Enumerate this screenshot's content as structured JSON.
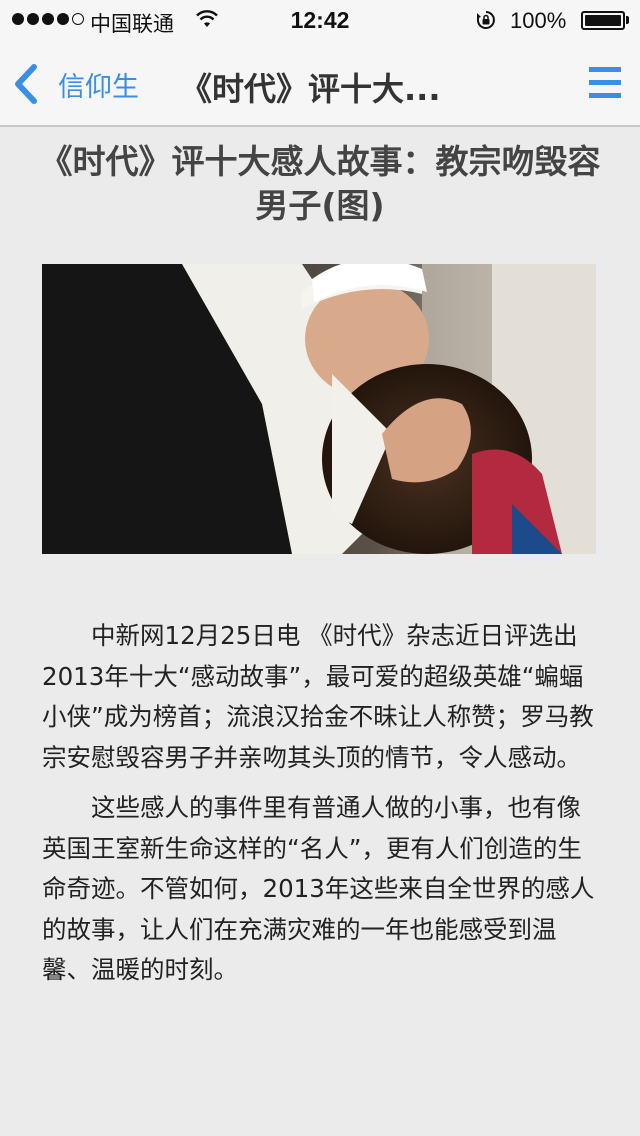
{
  "status_bar": {
    "signal_bars": 4,
    "signal_total": 5,
    "carrier": "中国联通",
    "time": "12:42",
    "battery_percent": "100%",
    "battery_level": 1.0
  },
  "nav": {
    "back_label": "信仰生",
    "title": "《时代》评十大...",
    "icons": {
      "back": "chevron-left-icon",
      "menu": "hamburger-menu-icon"
    },
    "accent_color": "#3a8ee6"
  },
  "article": {
    "title": "《时代》评十大感人故事：教宗吻毁容男子(图)",
    "paragraphs": [
      "中新网12月25日电 《时代》杂志近日评选出2013年十大“感动故事”，最可爱的超级英雄“蝙蝠小侠”成为榜首；流浪汉拾金不昧让人称赞；罗马教宗安慰毁容男子并亲吻其头顶的情节，令人感动。",
      "这些感人的事件里有普通人做的小事，也有像英国王室新生命这样的“名人”，更有人们创造的生命奇迹。不管如何，2013年这些来自全世界的感人的故事，让人们在充满灾难的一年也能感受到温馨、温暖的时刻。"
    ]
  }
}
